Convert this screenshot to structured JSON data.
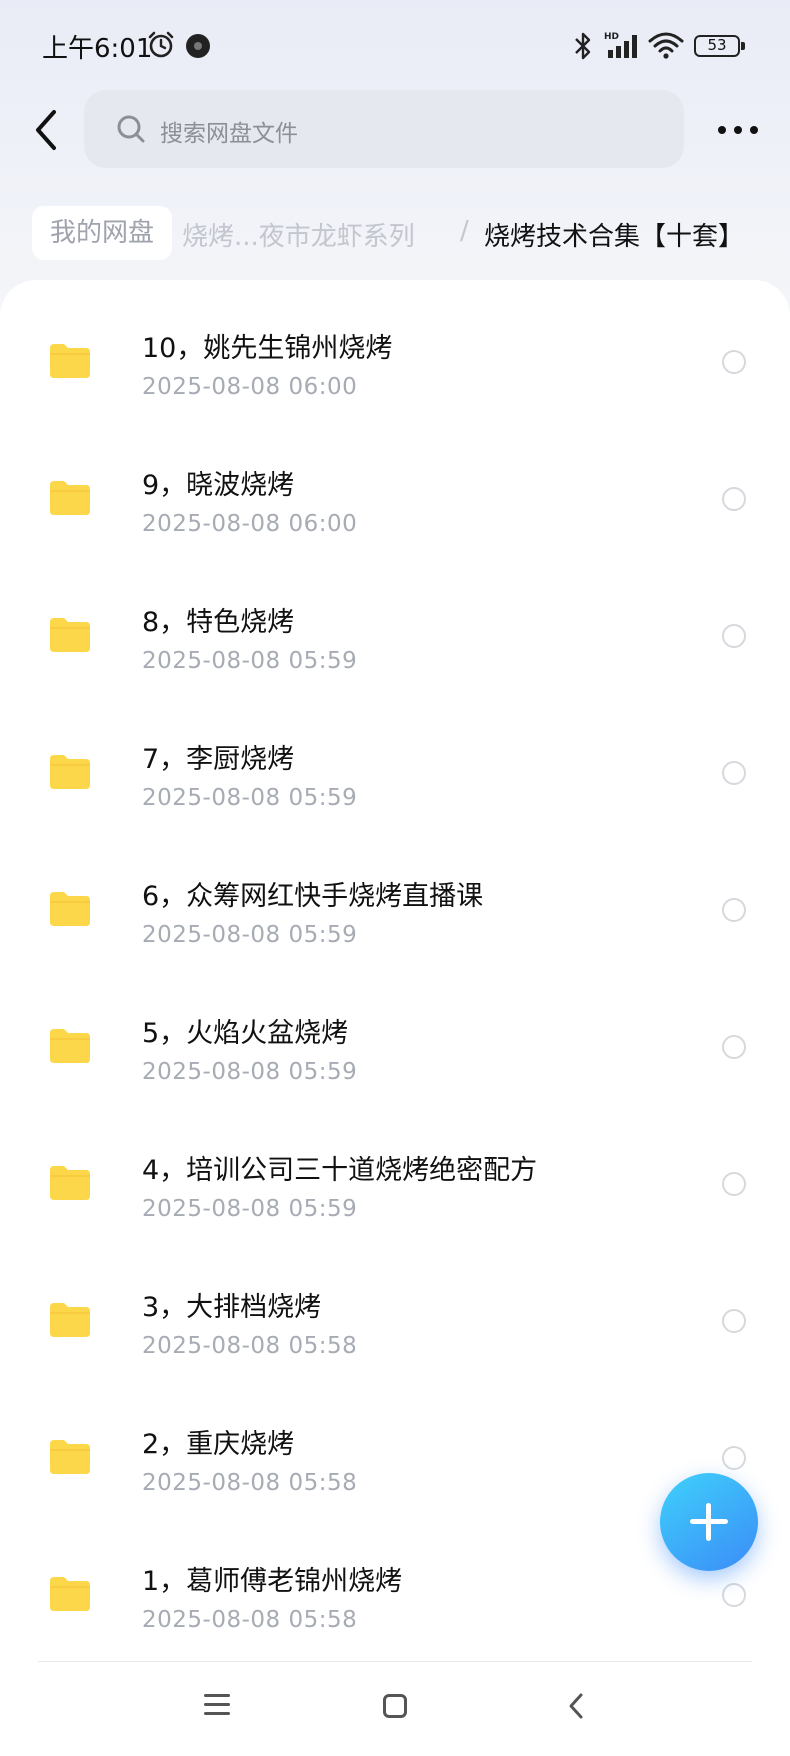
{
  "status_bar": {
    "time": "上午6:01",
    "battery": "53",
    "icons": [
      "alarm-icon",
      "app-notification-icon",
      "bluetooth-icon",
      "hd-signal-icon",
      "wifi-icon",
      "battery-icon"
    ]
  },
  "header": {
    "search_placeholder": "搜索网盘文件"
  },
  "breadcrumb": {
    "root": "我的网盘",
    "middle": "烧烤...夜市龙虾系列",
    "separator": "/",
    "current": "烧烤技术合集【十套】"
  },
  "files": [
    {
      "name": "10，姚先生锦州烧烤",
      "date": "2025-08-08  06:00"
    },
    {
      "name": "9，晓波烧烤",
      "date": "2025-08-08  06:00"
    },
    {
      "name": "8，特色烧烤",
      "date": "2025-08-08  05:59"
    },
    {
      "name": "7，李厨烧烤",
      "date": "2025-08-08  05:59"
    },
    {
      "name": "6，众筹网红快手烧烤直播课",
      "date": "2025-08-08  05:59"
    },
    {
      "name": "5，火焰火盆烧烤",
      "date": "2025-08-08  05:59"
    },
    {
      "name": "4，培训公司三十道烧烤绝密配方",
      "date": "2025-08-08  05:59"
    },
    {
      "name": "3，大排档烧烤",
      "date": "2025-08-08  05:58"
    },
    {
      "name": "2，重庆烧烤",
      "date": "2025-08-08  05:58"
    },
    {
      "name": "1，葛师傅老锦州烧烤",
      "date": "2025-08-08  05:58"
    }
  ],
  "colors": {
    "folder": "#FDD74A",
    "fab_start": "#3FD1FB",
    "fab_end": "#3B8CF7",
    "date_text": "#A7ABB4"
  }
}
